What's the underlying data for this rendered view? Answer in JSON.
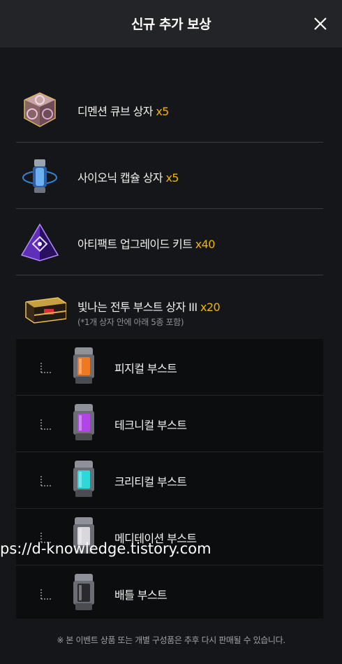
{
  "dialog": {
    "title": "신규 추가 보상",
    "close_icon": "close-icon"
  },
  "rewards": [
    {
      "name": "디멘션 큐브 상자",
      "qty": "x5",
      "icon": "dimension-cube-icon"
    },
    {
      "name": "사이오닉 캡슐 상자",
      "qty": "x5",
      "icon": "psionic-capsule-icon"
    },
    {
      "name": "아티팩트 업그레이드 키트",
      "qty": "x40",
      "icon": "artifact-kit-icon"
    },
    {
      "name": "빛나는 전투 부스트 상자 III",
      "qty": "x20",
      "note": "(*1개 상자 안에 아래 5종 포함)",
      "icon": "boost-chest-icon"
    }
  ],
  "boosts": [
    {
      "name": "피지컬 부스트",
      "color": "#f07820",
      "icon": "physical-boost-icon"
    },
    {
      "name": "테크니컬 부스트",
      "color": "#b145e8",
      "icon": "technical-boost-icon"
    },
    {
      "name": "크리티컬 부스트",
      "color": "#2fd8d8",
      "icon": "critical-boost-icon"
    },
    {
      "name": "메디테이션 부스트",
      "color": "#d8d8dc",
      "icon": "meditation-boost-icon"
    },
    {
      "name": "배틀 부스트",
      "color": "#2a2a2e",
      "icon": "battle-boost-icon"
    }
  ],
  "watermark": "ps://d-knowledge.tistory.com",
  "footer": "※ 본 이벤트 상품 또는 개별 구성품은 추후 다시 판매될 수 있습니다.",
  "colors": {
    "accent": "#f1b400",
    "background": "#151619",
    "header": "#232427",
    "sub_panel": "#0c0d0f"
  }
}
